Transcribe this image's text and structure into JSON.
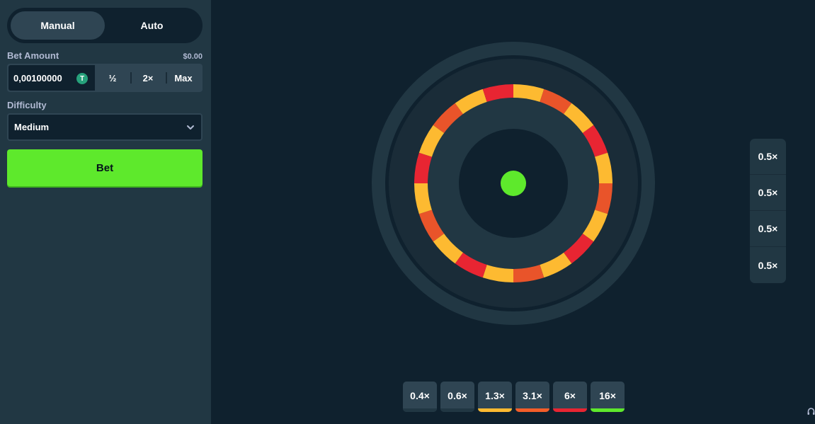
{
  "mode": {
    "tabs": [
      {
        "label": "Manual",
        "active": true
      },
      {
        "label": "Auto",
        "active": false
      }
    ]
  },
  "bet": {
    "label": "Bet Amount",
    "usd_value": "$0.00",
    "amount": "0,00100000",
    "currency_icon": "tether-coin-icon",
    "currency_symbol": "T",
    "half_label": "½",
    "double_label": "2×",
    "max_label": "Max"
  },
  "difficulty": {
    "label": "Difficulty",
    "selected": "Medium"
  },
  "bet_button": {
    "label": "Bet"
  },
  "side_multipliers": [
    "0.5×",
    "0.5×",
    "0.5×",
    "0.5×"
  ],
  "multipliers": [
    {
      "label": "0.4×",
      "color": "#213743"
    },
    {
      "label": "0.6×",
      "color": "#213743"
    },
    {
      "label": "1.3×",
      "color": "#fdba31"
    },
    {
      "label": "3.1×",
      "color": "#f35d29"
    },
    {
      "label": "6×",
      "color": "#e82532"
    },
    {
      "label": "16×",
      "color": "#5ee92c"
    }
  ],
  "wheel": {
    "segment_colors": [
      "#fdba31",
      "#e9542a",
      "#fdba31",
      "#e82532",
      "#fdba31",
      "#e9542a",
      "#fdba31",
      "#e82532",
      "#fdba31",
      "#e9542a",
      "#fdba31",
      "#e82532",
      "#fdba31",
      "#e9542a",
      "#fdba31",
      "#e82532",
      "#fdba31",
      "#e9542a",
      "#fdba31",
      "#e82532"
    ],
    "indicator_color": "#5ee92c"
  },
  "colors": {
    "background": "#0f212e",
    "panel": "#213743",
    "control": "#2f4553",
    "accent": "#5ee92c"
  }
}
